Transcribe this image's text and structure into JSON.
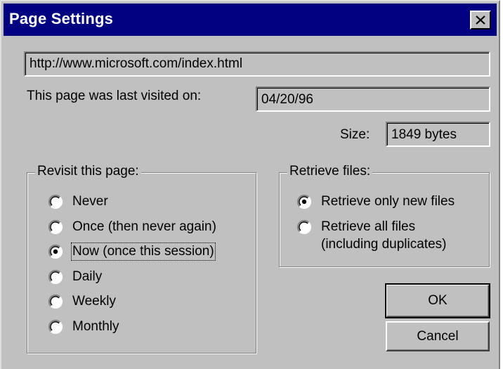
{
  "window": {
    "title": "Page Settings",
    "close_icon": "close-icon"
  },
  "url": "http://www.microsoft.com/index.html",
  "last_visited": {
    "label": "This page was last visited on:",
    "value": "04/20/96"
  },
  "size": {
    "label": "Size:",
    "value": "1849 bytes"
  },
  "revisit": {
    "legend": "Revisit this page:",
    "options": [
      {
        "label": "Never",
        "checked": false
      },
      {
        "label": "Once (then never again)",
        "checked": false
      },
      {
        "label": "Now (once this session)",
        "checked": true
      },
      {
        "label": "Daily",
        "checked": false
      },
      {
        "label": "Weekly",
        "checked": false
      },
      {
        "label": "Monthly",
        "checked": false
      }
    ]
  },
  "retrieve": {
    "legend": "Retrieve files:",
    "options": [
      {
        "label": "Retrieve only new files",
        "checked": true
      },
      {
        "label": "Retrieve all files",
        "label_line2": "(including duplicates)",
        "checked": false
      }
    ]
  },
  "buttons": {
    "ok": "OK",
    "cancel": "Cancel"
  }
}
